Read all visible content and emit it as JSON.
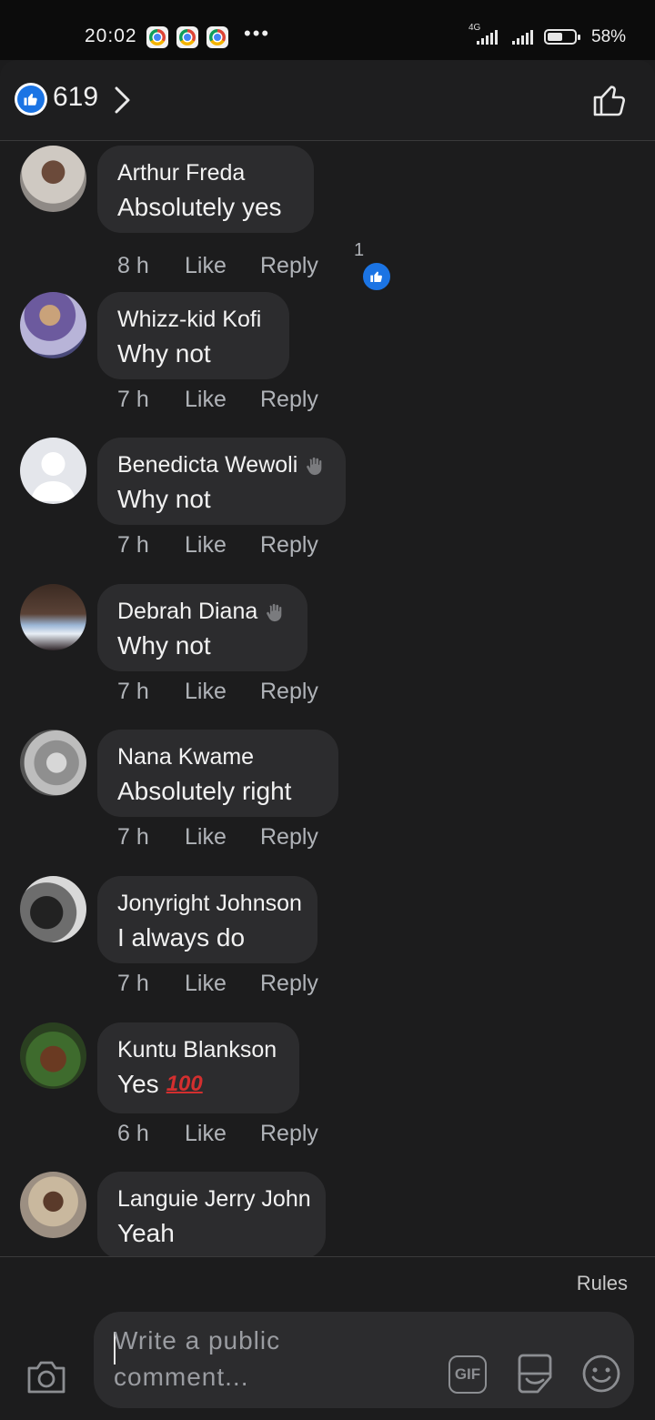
{
  "status_bar": {
    "time": "20:02",
    "network": "4G",
    "battery": "58%",
    "battery_level": 0.58
  },
  "header": {
    "reaction_count": "619"
  },
  "comments": [
    {
      "author": "Arthur Freda",
      "text": "Absolutely yes",
      "time": "8 h",
      "like": "Like",
      "reply": "Reply",
      "reactions": "1"
    },
    {
      "author": "Whizz-kid Kofi",
      "text": "Why not",
      "time": "7 h",
      "like": "Like",
      "reply": "Reply"
    },
    {
      "author": "Benedicta Wewoli",
      "text": "Why not",
      "time": "7 h",
      "like": "Like",
      "reply": "Reply"
    },
    {
      "author": "Debrah Diana",
      "text": "Why not",
      "time": "7 h",
      "like": "Like",
      "reply": "Reply"
    },
    {
      "author": "Nana Kwame",
      "text": "Absolutely right",
      "time": "7 h",
      "like": "Like",
      "reply": "Reply"
    },
    {
      "author": "Jonyright Johnson",
      "text": "I always do",
      "time": "7 h",
      "like": "Like",
      "reply": "Reply"
    },
    {
      "author": "Kuntu Blankson",
      "text": "Yes",
      "emoji": "100",
      "time": "6 h",
      "like": "Like",
      "reply": "Reply"
    },
    {
      "author": "Languie Jerry John",
      "text": "Yeah"
    }
  ],
  "footer": {
    "rules": "Rules",
    "placeholder": "Write a public comment...",
    "gif": "GIF"
  }
}
